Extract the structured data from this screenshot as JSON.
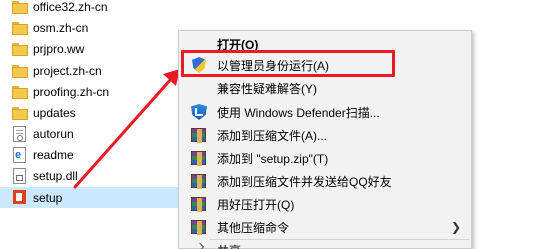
{
  "files": [
    {
      "name": "office32.zh-cn",
      "type": "folder"
    },
    {
      "name": "osm.zh-cn",
      "type": "folder"
    },
    {
      "name": "prjpro.ww",
      "type": "folder"
    },
    {
      "name": "project.zh-cn",
      "type": "folder"
    },
    {
      "name": "proofing.zh-cn",
      "type": "folder"
    },
    {
      "name": "updates",
      "type": "folder"
    },
    {
      "name": "autorun",
      "type": "settings-file"
    },
    {
      "name": "readme",
      "type": "html-file"
    },
    {
      "name": "setup.dll",
      "type": "dll-file"
    },
    {
      "name": "setup",
      "type": "office-setup-exe",
      "selected": true
    }
  ],
  "context_menu": {
    "items": [
      {
        "label": "打开(O)",
        "bold": true,
        "icon": "none"
      },
      {
        "label": "以管理员身份运行(A)",
        "icon": "uac-shield-icon",
        "highlighted": true
      },
      {
        "label": "兼容性疑难解答(Y)",
        "icon": "none"
      },
      {
        "label": "使用 Windows Defender扫描...",
        "icon": "windows-defender-icon"
      },
      {
        "label": "添加到压缩文件(A)...",
        "icon": "winrar-icon"
      },
      {
        "label": "添加到 \"setup.zip\"(T)",
        "icon": "winrar-icon"
      },
      {
        "label": "添加到压缩文件并发送给QQ好友",
        "icon": "winrar-icon"
      },
      {
        "label": "用好压打开(Q)",
        "icon": "winrar-icon"
      },
      {
        "label": "其他压缩命令",
        "icon": "winrar-icon",
        "submenu": true
      },
      {
        "label": "共享",
        "icon": "share-icon"
      }
    ],
    "submenu_glyph": "❯"
  },
  "colors": {
    "selection": "#cce8ff",
    "highlight_border": "#e81b23",
    "arrow": "#e81b23",
    "menu_bg": "#f2f2f2"
  }
}
